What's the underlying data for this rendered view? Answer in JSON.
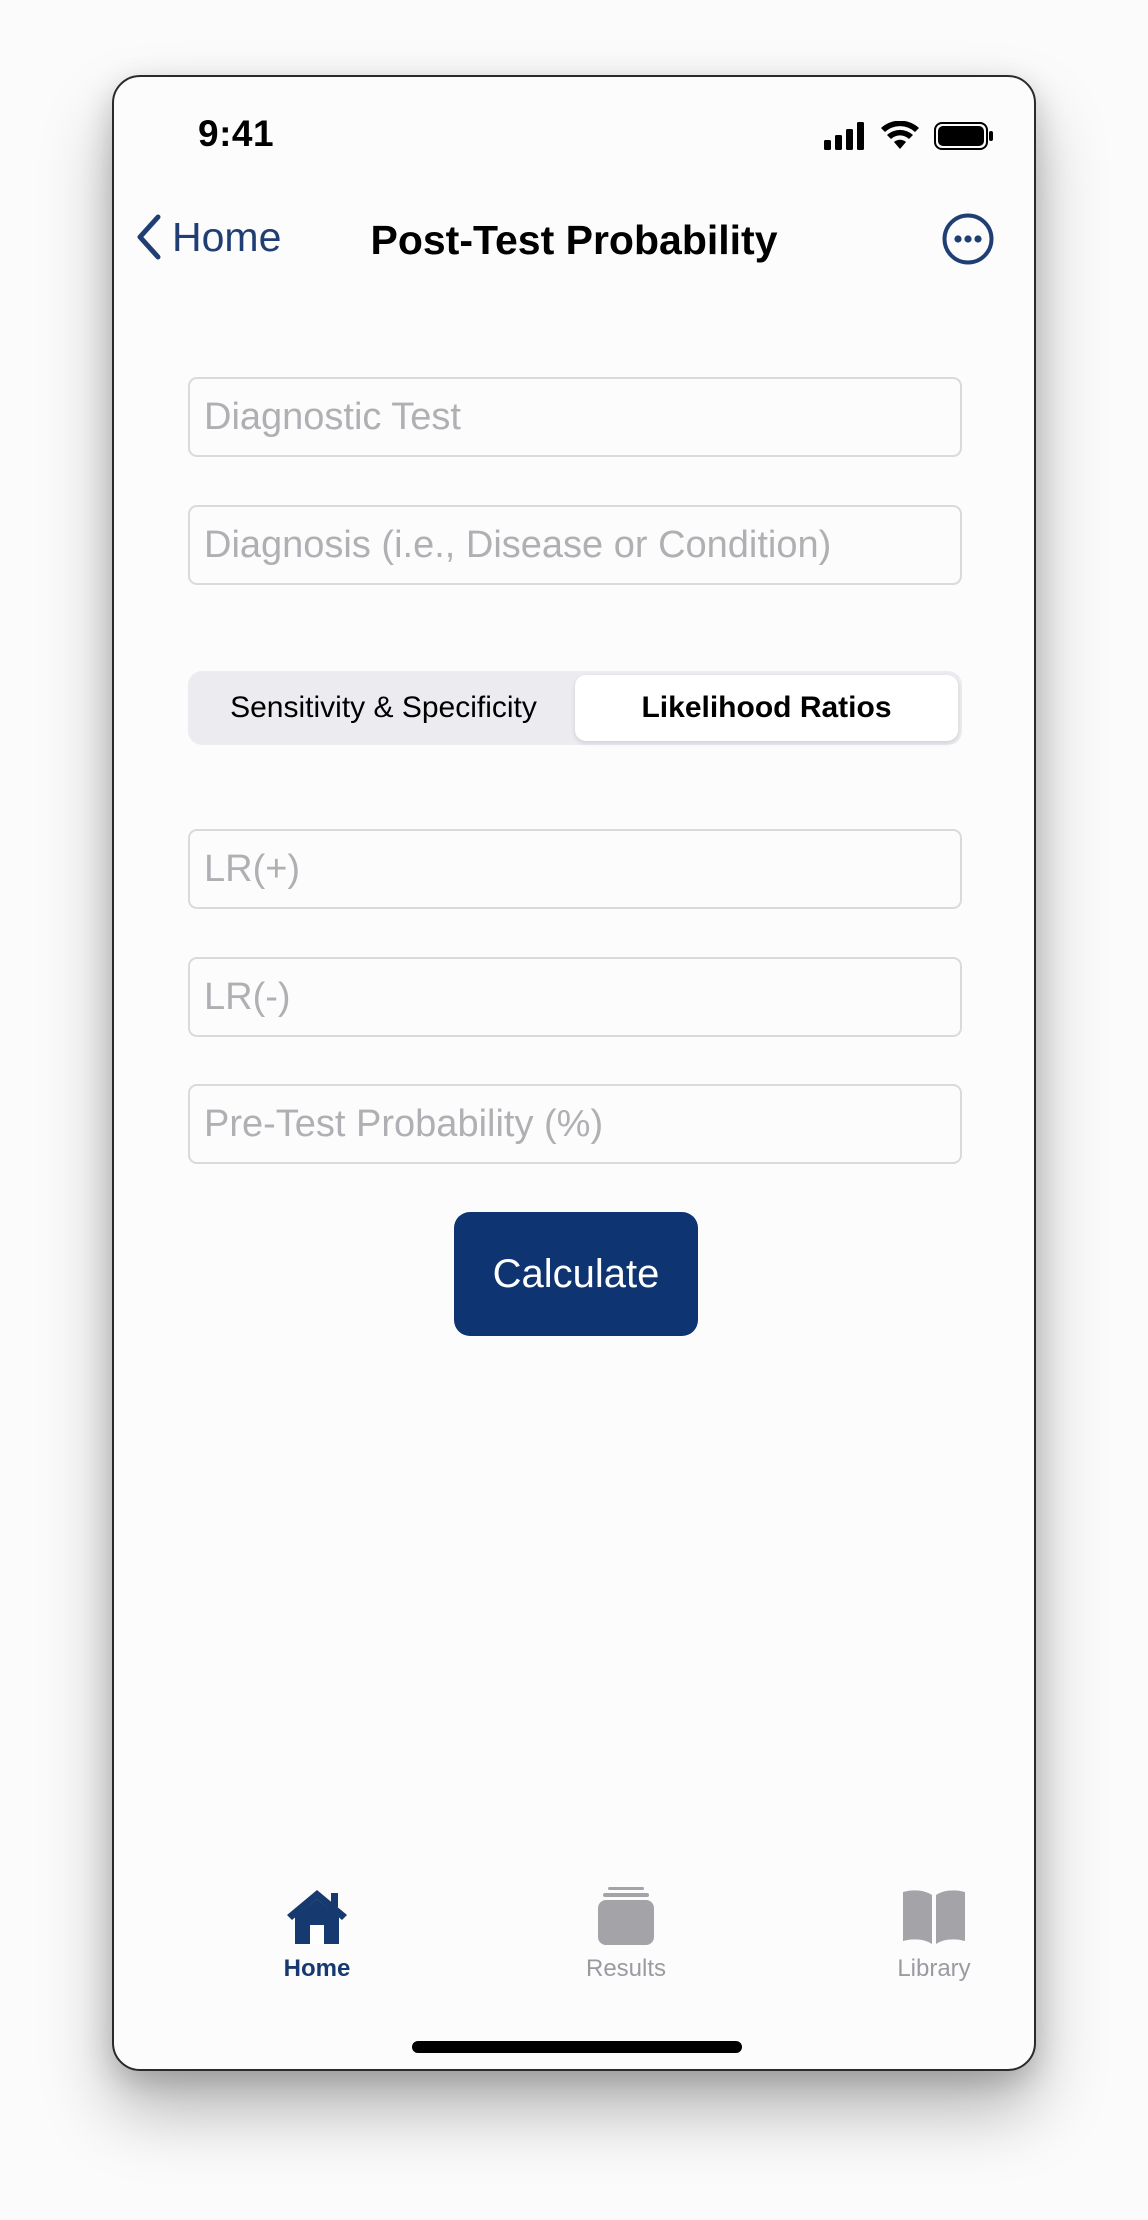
{
  "status_bar": {
    "time": "9:41"
  },
  "nav": {
    "back_label": "Home",
    "title": "Post-Test Probability"
  },
  "form": {
    "diagnostic_test_placeholder": "Diagnostic Test",
    "diagnosis_placeholder": "Diagnosis (i.e., Disease or Condition)",
    "lr_positive_placeholder": "LR(+)",
    "lr_negative_placeholder": "LR(-)",
    "pretest_placeholder": "Pre-Test Probability (%)"
  },
  "segmented": {
    "options": [
      "Sensitivity & Specificity",
      "Likelihood Ratios"
    ],
    "selected": "Likelihood Ratios"
  },
  "calculate_label": "Calculate",
  "tab_bar": {
    "items": [
      {
        "label": "Home",
        "icon": "house-icon",
        "active": true
      },
      {
        "label": "Results",
        "icon": "stack-icon",
        "active": false
      },
      {
        "label": "Library",
        "icon": "book-icon",
        "active": false
      }
    ]
  },
  "colors": {
    "accent": "#0e3571",
    "nav_tint": "#1f3e73",
    "inactive_tab": "#9a9aa0"
  }
}
